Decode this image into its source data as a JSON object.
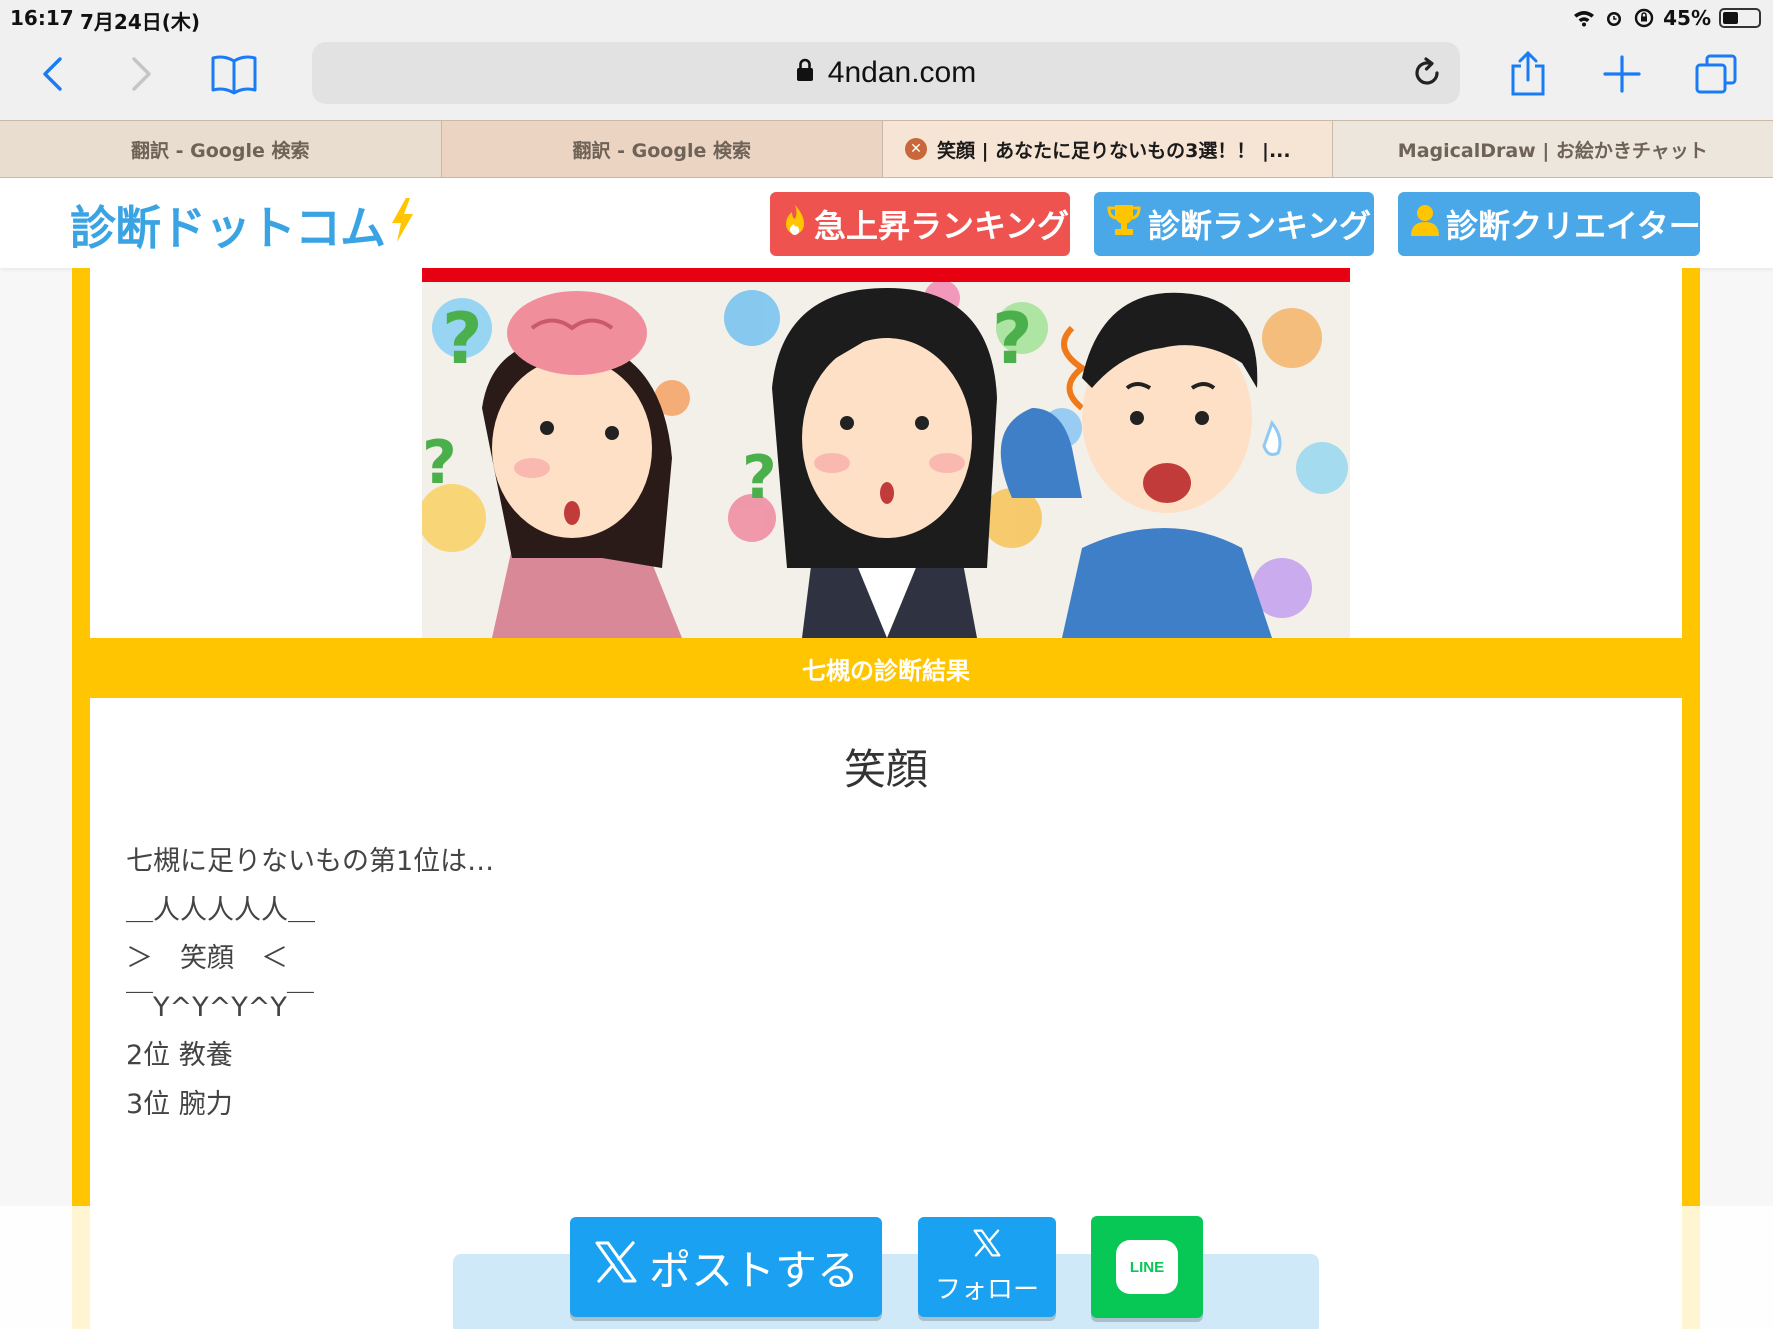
{
  "status_bar": {
    "time": "16:17",
    "date": "7月24日(木)",
    "battery": "45%",
    "battery_level": 0.45
  },
  "browser": {
    "url": "4ndan.com",
    "tabs": [
      {
        "label": "翻訳 - Google 検索"
      },
      {
        "label": "翻訳 - Google 検索"
      },
      {
        "label": "笑顔 | あなたに足りないもの3選！！ |..."
      },
      {
        "label": "MagicalDraw | お絵かきチャット"
      }
    ]
  },
  "site": {
    "logo_text": "診断ドットコム",
    "nav": {
      "hot_ranking": "急上昇ランキング",
      "ranking": "診断ランキング",
      "creator": "診断クリエイター"
    }
  },
  "result": {
    "band_label": "七槻の診断結果",
    "title": "笑顔",
    "lines": [
      "七槻に足りないもの第1位は…",
      "＿人人人人人＿",
      "＞　笑顔　＜",
      "￣Y^Y^Y^Y￣",
      "2位 教養",
      "3位 腕力"
    ]
  },
  "share": {
    "post_label": "ポストする",
    "follow_label": "フォロー",
    "line_label": "LINE"
  },
  "colors": {
    "accent_yellow": "#ffc501",
    "hot_red": "#ef5350",
    "nav_blue": "#4aa8e8",
    "x_blue": "#1ba1f1",
    "line_green": "#07c755"
  }
}
